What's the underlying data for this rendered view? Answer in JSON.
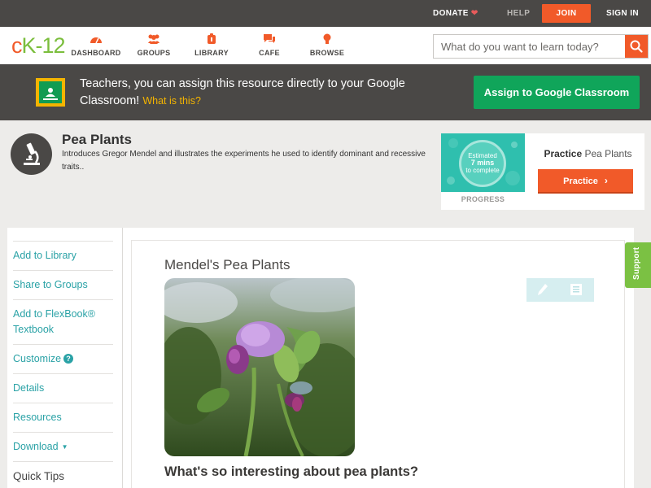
{
  "topbar": {
    "donate": "DONATE",
    "help": "HELP",
    "join": "JOIN",
    "signin": "SIGN IN"
  },
  "nav": {
    "logo": {
      "c": "c",
      "k": "K",
      "dash": "-",
      "num": "12"
    },
    "items": [
      {
        "label": "DASHBOARD",
        "icon": "dashboard-icon"
      },
      {
        "label": "GROUPS",
        "icon": "groups-icon"
      },
      {
        "label": "LIBRARY",
        "icon": "library-icon"
      },
      {
        "label": "CAFE",
        "icon": "cafe-icon"
      },
      {
        "label": "BROWSE",
        "icon": "browse-icon"
      }
    ],
    "search_placeholder": "What do you want to learn today?"
  },
  "banner": {
    "text": "Teachers, you can assign this resource directly to your Google Classroom!",
    "link": "What is this?",
    "button": "Assign to Google Classroom"
  },
  "concept": {
    "title": "Pea Plants",
    "description": "Introduces Gregor Mendel and illustrates the experiments he used to identify dominant and recessive traits.."
  },
  "practice": {
    "estimated": "Estimated",
    "mins": "7 mins",
    "to_complete": "to complete",
    "progress": "PROGRESS",
    "title_bold": "Practice",
    "title_rest": "Pea Plants",
    "button": "Practice"
  },
  "sidebar": {
    "items": [
      "Add to Library",
      "Share to Groups",
      "Add to FlexBook® Textbook",
      "Customize",
      "Details",
      "Resources",
      "Download",
      "Quick Tips"
    ]
  },
  "content": {
    "title": "Mendel's Pea Plants",
    "heading": "What's so interesting about pea plants?"
  },
  "support": "Support",
  "colors": {
    "accent": "#f15a29",
    "teal": "#2aa2a6",
    "green": "#10a55a",
    "dark": "#4a4846"
  }
}
